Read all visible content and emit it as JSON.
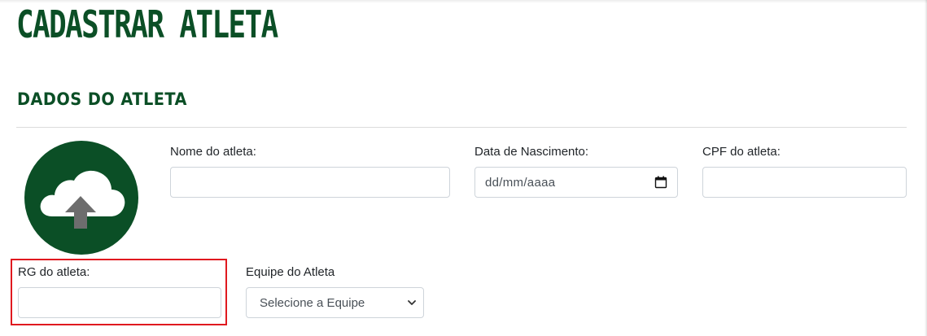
{
  "header": {
    "page_title": "CADASTRAR ATLETA"
  },
  "section": {
    "title": "DADOS DO ATLETA"
  },
  "photo_upload": {
    "icon": "cloud-upload-icon"
  },
  "fields": {
    "nome": {
      "label": "Nome do atleta:",
      "value": ""
    },
    "nascimento": {
      "label": "Data de Nascimento:",
      "placeholder": "dd/mm/aaaa",
      "icon": "calendar-icon"
    },
    "cpf": {
      "label": "CPF do atleta:",
      "value": ""
    },
    "rg": {
      "label": "RG do atleta:",
      "value": ""
    },
    "equipe": {
      "label": "Equipe do Atleta",
      "selected": "Selecione a Equipe",
      "icon": "chevron-down-icon"
    }
  },
  "colors": {
    "brand_green": "#0b4f26",
    "highlight_red": "#e0191f",
    "input_border": "#ced4da"
  }
}
